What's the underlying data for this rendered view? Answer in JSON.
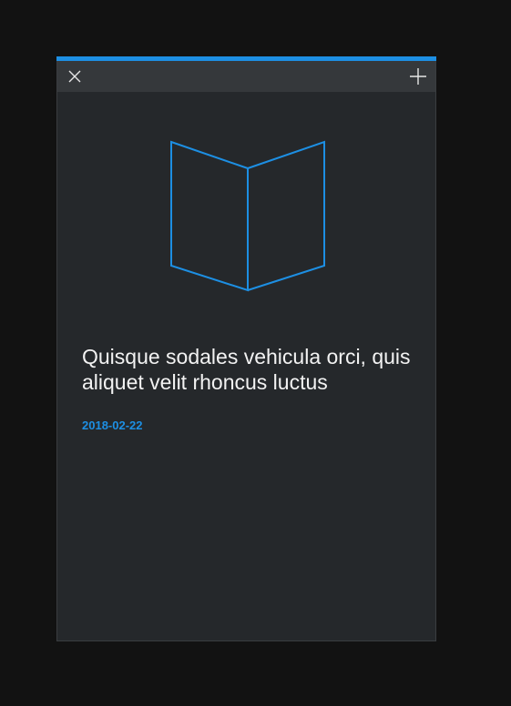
{
  "card": {
    "title": "Quisque sodales vehicula orci, quis aliquet velit rhoncus luctus",
    "date": "2018-02-22"
  },
  "toolbar": {
    "close_icon": "close-icon",
    "add_icon": "plus-icon"
  },
  "illustration": {
    "icon": "open-book-icon"
  },
  "colors": {
    "background": "#121212",
    "card": "#25282b",
    "toolbar": "#35383b",
    "accent": "#1d8fe3",
    "text": "#f2f2f2"
  }
}
